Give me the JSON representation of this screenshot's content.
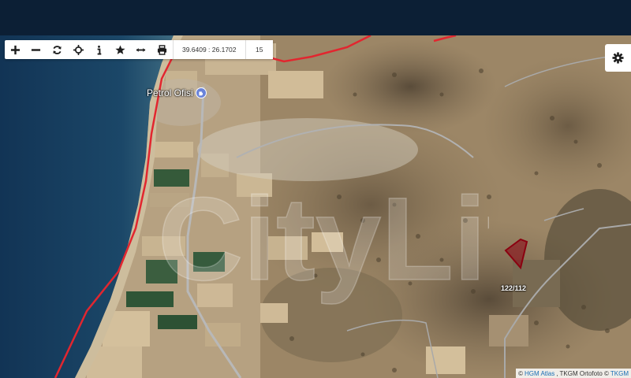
{
  "toolbar": {
    "buttons": [
      {
        "name": "zoom-in",
        "icon": "plus-icon"
      },
      {
        "name": "zoom-out",
        "icon": "minus-icon"
      },
      {
        "name": "refresh",
        "icon": "refresh-icon"
      },
      {
        "name": "locate",
        "icon": "crosshair-icon"
      },
      {
        "name": "info",
        "icon": "info-icon"
      },
      {
        "name": "favorite",
        "icon": "star-icon"
      },
      {
        "name": "measure",
        "icon": "measure-icon"
      },
      {
        "name": "print",
        "icon": "print-icon"
      }
    ],
    "coordinates": "39.6409 : 26.1702",
    "zoom_level": "15"
  },
  "settings": {
    "icon": "gear-icon"
  },
  "map": {
    "poi_label": "Petrol Ofisi",
    "poi_icon": "fuel-pin-icon",
    "parcel_label": "122/112",
    "watermark_text": "CityLife",
    "boundary_color": "#e2262f",
    "parcel_color": "#8b0010",
    "sea_color": "#163a5c"
  },
  "attribution": {
    "prefix": "©",
    "link1": "HGM Atlas",
    "middle": ", TKGM Ortofoto ©",
    "link2": "TKGM"
  }
}
